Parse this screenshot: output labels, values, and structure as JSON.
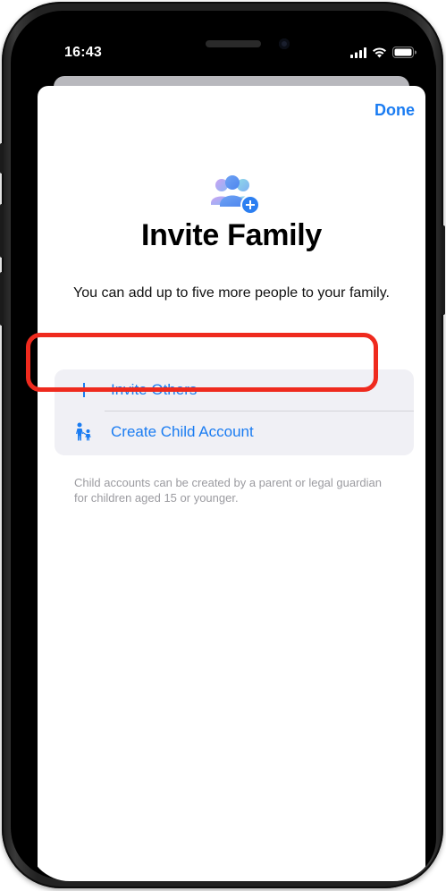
{
  "status_bar": {
    "time": "16:43",
    "icons": [
      "cellular-signal-icon",
      "wifi-icon",
      "battery-icon"
    ]
  },
  "nav": {
    "done_label": "Done"
  },
  "header": {
    "icon": "family-add-icon",
    "title": "Invite Family",
    "subtitle": "You can add up to five more people to your family."
  },
  "options": [
    {
      "label": "Invite Others",
      "icon": "plus-icon"
    },
    {
      "label": "Create Child Account",
      "icon": "child-icon"
    }
  ],
  "footnote": "Child accounts can be created by a parent or legal guardian for children aged 15 or younger.",
  "colors": {
    "accent": "#1a7cf2",
    "highlight": "#ef2a1e",
    "group_bg": "#f0f0f5",
    "footnote": "#9b9ba0"
  }
}
